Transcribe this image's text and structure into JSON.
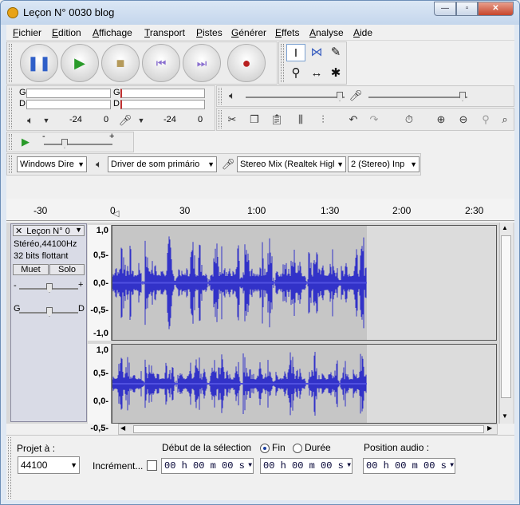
{
  "window": {
    "title": "Leçon N° 0030 blog",
    "min": "0",
    "max": "1",
    "close": "r"
  },
  "menu": [
    "Fichier",
    "Edition",
    "Affichage",
    "Transport",
    "Pistes",
    "Générer",
    "Effets",
    "Analyse",
    "Aide"
  ],
  "meters": {
    "left": "G",
    "right": "D",
    "ticks_out": [
      "-24",
      "0"
    ],
    "ticks_in": [
      "-24",
      "0"
    ]
  },
  "play_at_speed": {
    "minus": "-",
    "plus": "+"
  },
  "devices": {
    "host": "Windows Dire",
    "output": "Driver de som primário",
    "input": "Stereo Mix (Realtek Higl",
    "channels": "2 (Stereo) Inp"
  },
  "ruler": [
    "-30",
    "0",
    "30",
    "1:00",
    "1:30",
    "2:00",
    "2:30"
  ],
  "track": {
    "name": "Leçon N° 0",
    "close": "✕",
    "info1": "Stéréo,44100Hz",
    "info2": "32 bits flottant",
    "mute": "Muet",
    "solo": "Solo",
    "gain_minus": "-",
    "gain_plus": "+",
    "pan_left": "G",
    "pan_right": "D"
  },
  "scale_top": [
    "1,0",
    "0,5-",
    "0,0-",
    "-0,5-",
    "-1,0"
  ],
  "scale_bottom": [
    "1,0",
    "0,5-",
    "0,0-",
    "-0,5-"
  ],
  "bottom": {
    "project_label": "Projet à :",
    "rate": "44100",
    "increment_label": "Incrément...",
    "selection_label": "Début de la sélection",
    "end_label": "Fin",
    "duration_label": "Durée",
    "position_label": "Position audio :",
    "time1": "00 h 00 m 00 s",
    "time2": "00 h 00 m 00 s",
    "time3": "00 h 00 m 00 s"
  },
  "colors": {
    "wave": "#3232c8",
    "selected_area": "#c6c6c6",
    "empty_area": "#dcdcdc",
    "record": "#b82020",
    "play": "#2a9a2a"
  }
}
